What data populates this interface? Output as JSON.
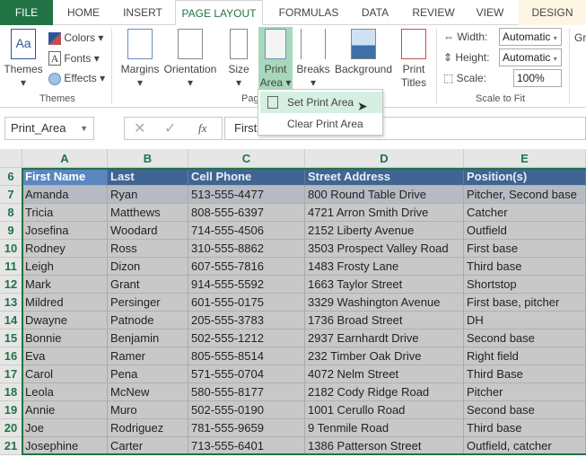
{
  "tabs": [
    "FILE",
    "HOME",
    "INSERT",
    "PAGE LAYOUT",
    "FORMULAS",
    "DATA",
    "REVIEW",
    "VIEW",
    "DESIGN"
  ],
  "ribbon": {
    "themes": {
      "themes": "Themes",
      "colors": "Colors",
      "fonts": "Fonts",
      "effects": "Effects",
      "group": "Themes"
    },
    "page_setup": {
      "margins": "Margins",
      "orientation": "Orientation",
      "size": "Size",
      "print_area_1": "Print",
      "print_area_2": "Area",
      "breaks": "Breaks",
      "background": "Background",
      "print_titles_1": "Print",
      "print_titles_2": "Titles",
      "group": "Pag"
    },
    "scale": {
      "width_label": "Width:",
      "width_value": "Automatic",
      "height_label": "Height:",
      "height_value": "Automatic",
      "scale_label": "Scale:",
      "scale_value": "100%",
      "group": "Scale to Fit"
    },
    "gridlines": "Gri"
  },
  "menu": {
    "set": "Set Print Area",
    "clear": "Clear Print Area"
  },
  "formula_bar": {
    "name_box": "Print_Area",
    "fx": "fx",
    "content": "First"
  },
  "columns": [
    "A",
    "B",
    "C",
    "D",
    "E"
  ],
  "header_row": {
    "row": "6",
    "cells": [
      "First Name",
      "Last",
      "Cell Phone",
      "Street Address",
      "Position(s)"
    ]
  },
  "rows": [
    {
      "row": "7",
      "cells": [
        "Amanda",
        "Ryan",
        "513-555-4477",
        "800 Round Table Drive",
        "Pitcher, Second base"
      ]
    },
    {
      "row": "8",
      "cells": [
        "Tricia",
        "Matthews",
        "808-555-6397",
        "4721 Arron Smith Drive",
        "Catcher"
      ]
    },
    {
      "row": "9",
      "cells": [
        "Josefina",
        "Woodard",
        "714-555-4506",
        "2152 Liberty Avenue",
        "Outfield"
      ]
    },
    {
      "row": "10",
      "cells": [
        "Rodney",
        "Ross",
        "310-555-8862",
        "3503 Prospect Valley Road",
        "First base"
      ]
    },
    {
      "row": "11",
      "cells": [
        "Leigh",
        "Dizon",
        "607-555-7816",
        "1483 Frosty Lane",
        "Third base"
      ]
    },
    {
      "row": "12",
      "cells": [
        "Mark",
        "Grant",
        "914-555-5592",
        "1663 Taylor Street",
        "Shortstop"
      ]
    },
    {
      "row": "13",
      "cells": [
        "Mildred",
        "Persinger",
        "601-555-0175",
        "3329 Washington Avenue",
        "First base, pitcher"
      ]
    },
    {
      "row": "14",
      "cells": [
        "Dwayne",
        "Patnode",
        "205-555-3783",
        "1736 Broad Street",
        "DH"
      ]
    },
    {
      "row": "15",
      "cells": [
        "Bonnie",
        "Benjamin",
        "502-555-1212",
        "2937 Earnhardt Drive",
        "Second base"
      ]
    },
    {
      "row": "16",
      "cells": [
        "Eva",
        "Ramer",
        "805-555-8514",
        "232 Timber Oak Drive",
        "Right field"
      ]
    },
    {
      "row": "17",
      "cells": [
        "Carol",
        "Pena",
        "571-555-0704",
        "4072 Nelm Street",
        "Third Base"
      ]
    },
    {
      "row": "18",
      "cells": [
        "Leola",
        "McNew",
        "580-555-8177",
        "2182 Cody Ridge Road",
        "Pitcher"
      ]
    },
    {
      "row": "19",
      "cells": [
        "Annie",
        "Muro",
        "502-555-0190",
        "1001 Cerullo Road",
        "Second base"
      ]
    },
    {
      "row": "20",
      "cells": [
        "Joe",
        "Rodriguez",
        "781-555-9659",
        "9 Tenmile Road",
        "Third base"
      ]
    },
    {
      "row": "21",
      "cells": [
        "Josephine",
        "Carter",
        "713-555-6401",
        "1386 Patterson Street",
        "Outfield, catcher"
      ]
    }
  ],
  "colors": {
    "accent": "#217346",
    "header_fill": "#416592",
    "selected_fill": "#c8c8c8"
  }
}
